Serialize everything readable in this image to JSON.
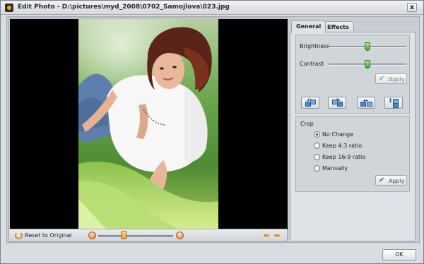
{
  "window": {
    "title": "Edit Photo - D:\\pictures\\myd_2008\\0702_Samojlova\\023.jpg",
    "close_label": "x"
  },
  "viewer": {
    "reset_label": "Reset to Original",
    "zoom_level_fraction": 0.34,
    "zoom_minus_label": "−",
    "zoom_plus_label": "+",
    "prev_label": "⬅",
    "next_label": "➡",
    "icons": {
      "reset": "reset-icon",
      "zoom_out": "zoom-out-icon",
      "zoom_in": "zoom-in-icon",
      "previous": "arrow-left-icon",
      "next": "arrow-right-icon"
    }
  },
  "tabs": [
    {
      "label": "General",
      "active": true
    },
    {
      "label": "Effects",
      "active": false
    }
  ],
  "adjustments": {
    "brightness_label": "Brightness",
    "brightness_level_fraction": 0.5,
    "contrast_label": "Contrast",
    "contrast_level_fraction": 0.5,
    "apply_label": "Apply",
    "apply_enabled": false
  },
  "transform_buttons": [
    {
      "icon": "rotate-left-icon"
    },
    {
      "icon": "rotate-right-icon"
    },
    {
      "icon": "flip-horizontal-icon"
    },
    {
      "icon": "flip-vertical-icon"
    }
  ],
  "crop": {
    "title": "Crop",
    "options": [
      {
        "label": "No Change",
        "checked": true
      },
      {
        "label": "Keep 4:3 ratio",
        "checked": false
      },
      {
        "label": "Keep 16:9 ratio",
        "checked": false
      },
      {
        "label": "Manually",
        "checked": false
      }
    ],
    "apply_label": "Apply",
    "apply_enabled": true
  },
  "footer": {
    "ok_label": "OK"
  },
  "colors": {
    "window_bg": "#d9dce0",
    "accent_orange": "#e28c17",
    "slider_green": "#4aa43a"
  }
}
